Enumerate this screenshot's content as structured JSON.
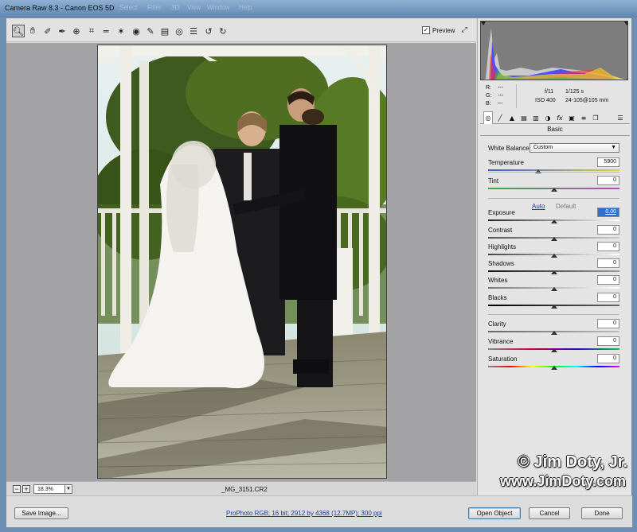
{
  "window": {
    "title": "Camera Raw 8.3  -  Canon EOS 5D",
    "background_menu": [
      "Select",
      "Filter",
      "3D",
      "View",
      "Window",
      "Help"
    ]
  },
  "toolbar": {
    "tools": [
      "zoom-tool",
      "hand-tool",
      "white-balance-tool",
      "color-sampler-tool",
      "targeted-adjustment-tool",
      "crop-tool",
      "straighten-tool",
      "spot-removal-tool",
      "red-eye-tool",
      "adjustment-brush",
      "graduated-filter",
      "radial-filter",
      "preferences",
      "rotate-ccw",
      "rotate-cw"
    ],
    "preview_label": "Preview",
    "preview_checked": true
  },
  "status": {
    "zoom_value": "18.3%",
    "filename": "_MG_3151.CR2"
  },
  "bottom": {
    "save_label": "Save Image...",
    "workflow_link": "ProPhoto RGB; 16 bit; 2912 by 4368 (12.7MP); 300 ppi",
    "open_label": "Open Object",
    "cancel_label": "Cancel",
    "done_label": "Done"
  },
  "readout": {
    "r": "R:",
    "g": "G:",
    "b": "B:",
    "r_val": "---",
    "g_val": "---",
    "b_val": "---",
    "aperture": "f/11",
    "shutter": "1/125 s",
    "iso": "ISO 400",
    "lens": "24-105@105 mm"
  },
  "panel": {
    "section_title": "Basic",
    "white_balance_label": "White Balance:",
    "white_balance_value": "Custom",
    "auto_label": "Auto",
    "default_label": "Default",
    "sliders": [
      {
        "label": "Temperature",
        "value": "5900",
        "pos": 0.38
      },
      {
        "label": "Tint",
        "value": "0",
        "pos": 0.5
      },
      {
        "label": "Exposure",
        "value": "0.00",
        "pos": 0.5,
        "selected": true
      },
      {
        "label": "Contrast",
        "value": "0",
        "pos": 0.5
      },
      {
        "label": "Highlights",
        "value": "0",
        "pos": 0.5
      },
      {
        "label": "Shadows",
        "value": "0",
        "pos": 0.5
      },
      {
        "label": "Whites",
        "value": "0",
        "pos": 0.5
      },
      {
        "label": "Blacks",
        "value": "0",
        "pos": 0.5
      },
      {
        "label": "Clarity",
        "value": "0",
        "pos": 0.5
      },
      {
        "label": "Vibrance",
        "value": "0",
        "pos": 0.5
      },
      {
        "label": "Saturation",
        "value": "0",
        "pos": 0.5
      }
    ]
  },
  "watermark": {
    "line1": "© Jim Doty, Jr.",
    "line2": "www.JimDoty.com"
  }
}
